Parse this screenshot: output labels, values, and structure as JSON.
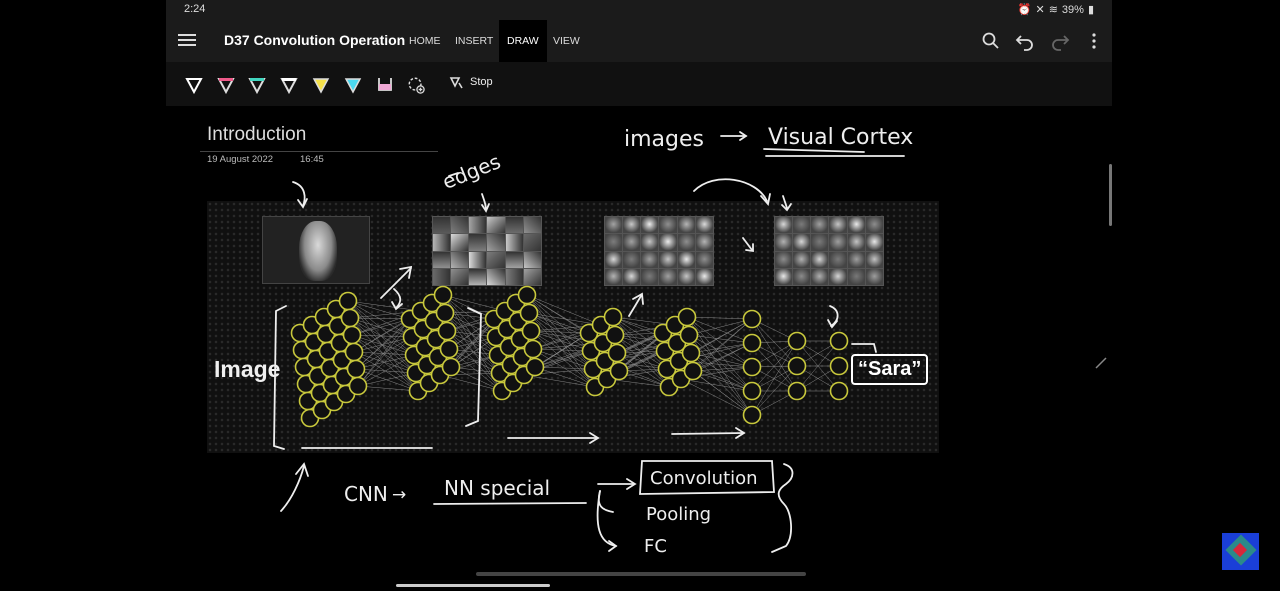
{
  "status_bar": {
    "time": "2:24",
    "battery": "39%"
  },
  "top_bar": {
    "title": "D37 Convolution Operation",
    "tabs": [
      {
        "label": "HOME",
        "active": false
      },
      {
        "label": "INSERT",
        "active": false
      },
      {
        "label": "DRAW",
        "active": true
      },
      {
        "label": "VIEW",
        "active": false
      }
    ],
    "actions": [
      "search-icon",
      "undo-icon",
      "redo-icon",
      "more-vertical-icon"
    ]
  },
  "draw_toolbar": {
    "tools": [
      {
        "name": "pen-white",
        "color": "#ffffff",
        "active": true
      },
      {
        "name": "pen-pink",
        "color": "#f05a8a"
      },
      {
        "name": "pen-teal",
        "color": "#41d6c0"
      },
      {
        "name": "pen-white-2",
        "color": "#ffffff"
      },
      {
        "name": "highlighter-yellow",
        "color": "#f5e14a"
      },
      {
        "name": "highlighter-cyan",
        "color": "#4ad8f0"
      },
      {
        "name": "highlighter-pink",
        "color": "#f0a8d6"
      }
    ],
    "stop_label": "Stop"
  },
  "page": {
    "title": "Introduction",
    "date": "19 August 2022",
    "time": "16:45"
  },
  "slide": {
    "input_label": "Image",
    "output_label": "“Sara”"
  },
  "handwriting": {
    "edges": "edges",
    "images_arrow": "images",
    "visual_cortex": "Visual Cortex",
    "cnn": "CNN",
    "nn_special": "NN special",
    "convolution": "Convolution",
    "pooling": "Pooling",
    "fc": "FC"
  },
  "colors": {
    "app_bg": "#1b1b1b",
    "canvas_bg": "#000000",
    "neuron_stroke": "#c8c83c"
  }
}
